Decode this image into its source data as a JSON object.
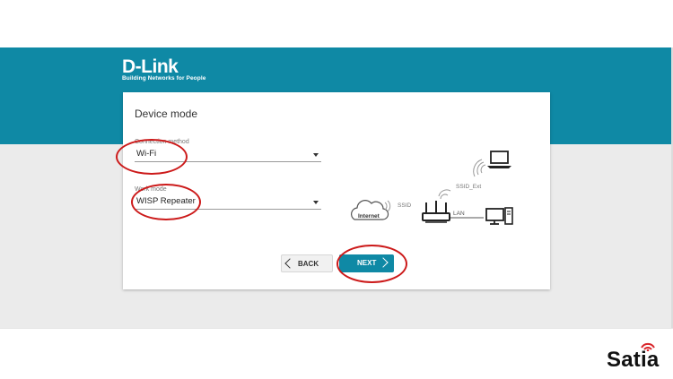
{
  "header": {
    "logo_text": "D-Link",
    "logo_tagline": "Building Networks for People"
  },
  "card": {
    "title": "Device mode",
    "connection_method": {
      "label": "Connection method",
      "value": "Wi-Fi"
    },
    "work_mode": {
      "label": "Work mode",
      "value": "WISP Repeater"
    }
  },
  "diagram": {
    "internet": "Internet",
    "ssid": "SSID",
    "ssid_ext": "SSID_Ext",
    "lan": "LAN"
  },
  "buttons": {
    "back": "BACK",
    "next": "NEXT"
  },
  "watermark": {
    "text": "Satia"
  },
  "colors": {
    "brand_teal": "#0f89a5",
    "annotation_red": "#cc1a1a",
    "background_grey": "#ebebeb"
  }
}
